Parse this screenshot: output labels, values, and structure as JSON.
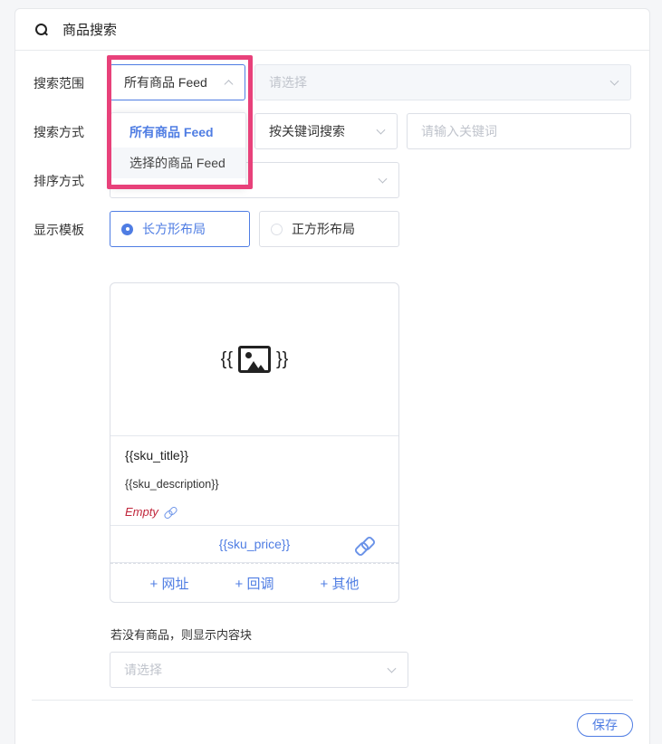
{
  "header": {
    "title": "商品搜索",
    "icon": "search-icon"
  },
  "search_scope": {
    "label": "搜索范围",
    "value": "所有商品 Feed",
    "secondary_placeholder": "请选择",
    "options": [
      "所有商品 Feed",
      "选择的商品 Feed"
    ]
  },
  "search_method": {
    "label": "搜索方式",
    "value": "按关键词搜索",
    "keyword_placeholder": "请输入关键词"
  },
  "sort": {
    "label": "排序方式"
  },
  "template": {
    "label": "显示模板",
    "options": [
      "长方形布局",
      "正方形布局"
    ],
    "selected": "长方形布局"
  },
  "card": {
    "image_open": "{{",
    "image_close": "}}",
    "sku_title": "{{sku_title}}",
    "sku_description": "{{sku_description}}",
    "empty_label": "Empty",
    "sku_price": "{{sku_price}}",
    "actions": [
      "+ 网址",
      "+ 回调",
      "+ 其他"
    ]
  },
  "fallback": {
    "label": "若没有商品，则显示内容块",
    "placeholder": "请选择"
  },
  "footer": {
    "save_label": "保存"
  },
  "colors": {
    "accent": "#4f7de3",
    "highlight": "#e8417a",
    "empty_text": "#c0263b"
  }
}
